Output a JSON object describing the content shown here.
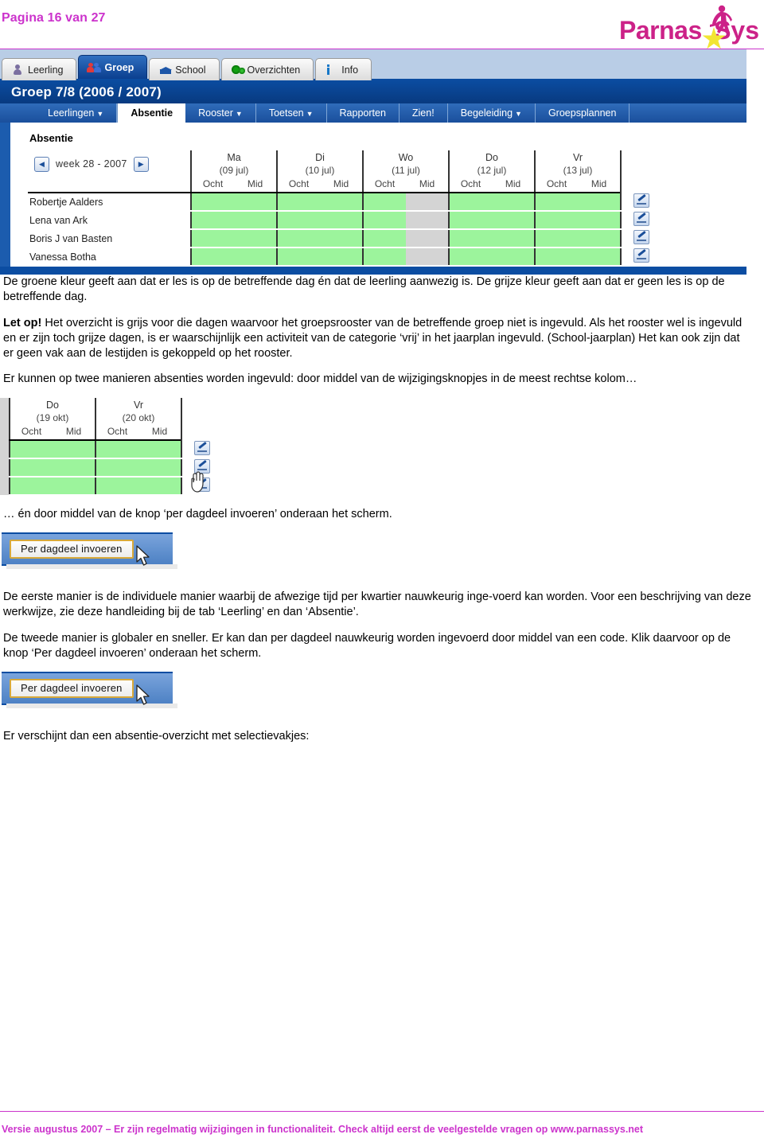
{
  "header": {
    "page_label": "Pagina 16 van 27",
    "logo": {
      "text_left": "Parnas",
      "text_right": "Sys",
      "color": "#cc2288",
      "star_color": "#f2e533"
    },
    "rule_color": "#cc33cc"
  },
  "app": {
    "main_tabs": [
      {
        "label": "Leerling",
        "icon": "person-icon",
        "active": false
      },
      {
        "label": "Groep",
        "icon": "group-icon",
        "active": true
      },
      {
        "label": "School",
        "icon": "school-icon",
        "active": false
      },
      {
        "label": "Overzichten",
        "icon": "gears-icon",
        "active": false
      },
      {
        "label": "Info",
        "icon": "info-icon",
        "active": false
      }
    ],
    "group_title": "Groep 7/8 (2006 / 2007)",
    "sub_tabs": [
      {
        "label": "Leerlingen",
        "caret": "▼",
        "active": false
      },
      {
        "label": "Absentie",
        "caret": "",
        "active": true
      },
      {
        "label": "Rooster",
        "caret": "▼",
        "active": false
      },
      {
        "label": "Toetsen",
        "caret": "▼",
        "active": false
      },
      {
        "label": "Rapporten",
        "caret": "",
        "active": false
      },
      {
        "label": "Zien!",
        "caret": "",
        "active": false
      },
      {
        "label": "Begeleiding",
        "caret": "▼",
        "active": false
      },
      {
        "label": "Groepsplannen",
        "caret": "",
        "active": false
      }
    ],
    "panel_title": "Absentie",
    "week_nav": {
      "prev_icon": "◀",
      "next_icon": "▶",
      "label": "week 28 - 2007"
    },
    "days": [
      {
        "day": "Ma",
        "date": "(09 jul)"
      },
      {
        "day": "Di",
        "date": "(10 jul)"
      },
      {
        "day": "Wo",
        "date": "(11 jul)"
      },
      {
        "day": "Do",
        "date": "(12 jul)"
      },
      {
        "day": "Vr",
        "date": "(13 jul)"
      }
    ],
    "slot_labels": [
      "Ocht",
      "Mid"
    ],
    "students": [
      "Robertje Aalders",
      "Lena van Ark",
      "Boris J van Basten",
      "Vanessa Botha"
    ],
    "cell_states": [
      [
        "green",
        "green",
        "green",
        "green",
        "green",
        "gray",
        "green",
        "green",
        "green",
        "green"
      ],
      [
        "green",
        "green",
        "green",
        "green",
        "green",
        "gray",
        "green",
        "green",
        "green",
        "green"
      ],
      [
        "green",
        "green",
        "green",
        "green",
        "green",
        "gray",
        "green",
        "green",
        "green",
        "green"
      ],
      [
        "green",
        "green",
        "green",
        "green",
        "green",
        "gray",
        "green",
        "green",
        "green",
        "green"
      ]
    ],
    "edit_button_title": "wijzigen",
    "colors": {
      "present_green": "#9cf49c",
      "no_lesson_gray": "#d4d4d4",
      "header_blue": "#0b4da2"
    }
  },
  "figure2": {
    "days": [
      {
        "day": "Do",
        "date": "(19 okt)"
      },
      {
        "day": "Vr",
        "date": "(20 okt)"
      }
    ],
    "slot_labels": [
      "Ocht",
      "Mid"
    ],
    "rows": 3
  },
  "buttons": {
    "per_dagdeel": "Per dagdeel invoeren"
  },
  "body": {
    "p1": "De groene kleur geeft aan dat er les is op de betreffende dag én dat de leerling aanwezig is. De grijze kleur geeft aan dat er geen les is op de betreffende dag.",
    "p2_bold": "Let op!",
    "p2": " Het overzicht is grijs voor die dagen waarvoor het groepsrooster van de betreffende groep niet is ingevuld. Als het rooster wel is ingevuld en er zijn toch grijze dagen, is er waarschijnlijk een activiteit van de categorie ‘vrij’ in het jaarplan ingevuld. (School-jaarplan) Het kan ook zijn dat er geen vak aan de lestijden is gekoppeld op het rooster.",
    "p3": "Er kunnen op twee manieren absenties worden ingevuld: door middel van de wijzigingsknopjes in de meest rechtse kolom…",
    "p4": "… én door middel van de knop ‘per dagdeel invoeren’ onderaan het scherm.",
    "p5": "De eerste manier is de individuele manier waarbij de afwezige tijd per kwartier nauwkeurig inge-voerd kan worden. Voor een beschrijving van deze werkwijze, zie deze handleiding bij de tab ‘Leerling’ en dan ‘Absentie’.",
    "p6": "De tweede manier is globaler en sneller. Er kan dan per dagdeel nauwkeurig worden ingevoerd door middel van een code. Klik daarvoor op de knop ‘Per dagdeel invoeren’ onderaan het scherm.",
    "p7": "Er verschijnt dan een absentie-overzicht met selectievakjes:"
  },
  "footer": {
    "text": "Versie augustus 2007 – Er zijn regelmatig wijzigingen in functionaliteit. Check altijd eerst de veelgestelde vragen op www.parnassys.net",
    "color": "#cc33cc"
  }
}
